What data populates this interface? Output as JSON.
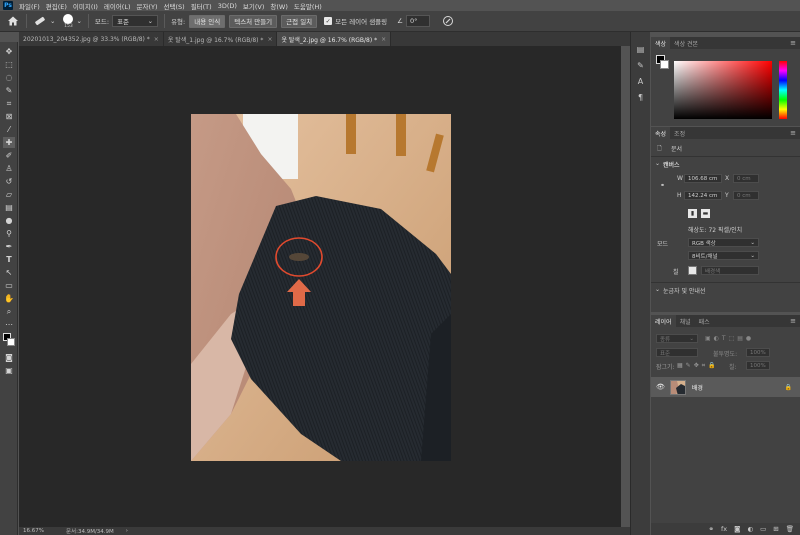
{
  "menubar": {
    "logo": "Ps",
    "items": [
      "파일(F)",
      "편집(E)",
      "이미지(I)",
      "레이어(L)",
      "문자(Y)",
      "선택(S)",
      "필터(T)",
      "3D(D)",
      "보기(V)",
      "창(W)",
      "도움말(H)"
    ]
  },
  "options": {
    "brush_size": "153",
    "mode_label": "모드:",
    "mode_value": "표준",
    "type_label": "유형:",
    "type_buttons": [
      "내용 인식",
      "텍스처 만들기",
      "근접 일치"
    ],
    "sample_all_label": "모든 레이어 샘플링",
    "angle_value": "0°"
  },
  "tabs": [
    {
      "label": "20201013_204352.jpg @ 33.3% (RGB/8) *",
      "active": false
    },
    {
      "label": "옷 탈색_1.jpg @ 16.7% (RGB/8) *",
      "active": false
    },
    {
      "label": "옷 탈색_2.jpg @ 16.7% (RGB/8) *",
      "active": true
    }
  ],
  "status": {
    "zoom": "16.67%",
    "doc": "문서:34.9M/34.9M",
    "arrow": "›"
  },
  "color_panel": {
    "tabs": [
      "색상",
      "색상 견본"
    ]
  },
  "properties_panel": {
    "tabs": [
      "속성",
      "조정"
    ],
    "doc_label": "문서",
    "canvas_section": "캔버스",
    "w_label": "W",
    "w_value": "106.68 cm",
    "h_label": "H",
    "h_value": "142.24 cm",
    "x_label": "X",
    "x_value": "0 cm",
    "y_label": "Y",
    "y_value": "0 cm",
    "resolution": "해상도: 72 픽셀/인치",
    "mode_label": "모드",
    "mode_value": "RGB 색상",
    "depth_value": "8비트/채널",
    "fill_label": "칠",
    "fill_value": "배경색",
    "rulers_section": "눈금자 및 안내선"
  },
  "layers_panel": {
    "tabs": [
      "레이어",
      "채널",
      "패스"
    ],
    "filter_label": "종류",
    "blend_mode": "표준",
    "opacity_label": "불투명도:",
    "opacity_value": "100%",
    "lock_label": "잠그기:",
    "fill_label": "칠:",
    "fill_value": "100%",
    "layer_name": "배경"
  },
  "colors": {
    "accent_red": "#e04a2e",
    "canvas_bg": "#282828",
    "ui_bg": "#424242"
  }
}
